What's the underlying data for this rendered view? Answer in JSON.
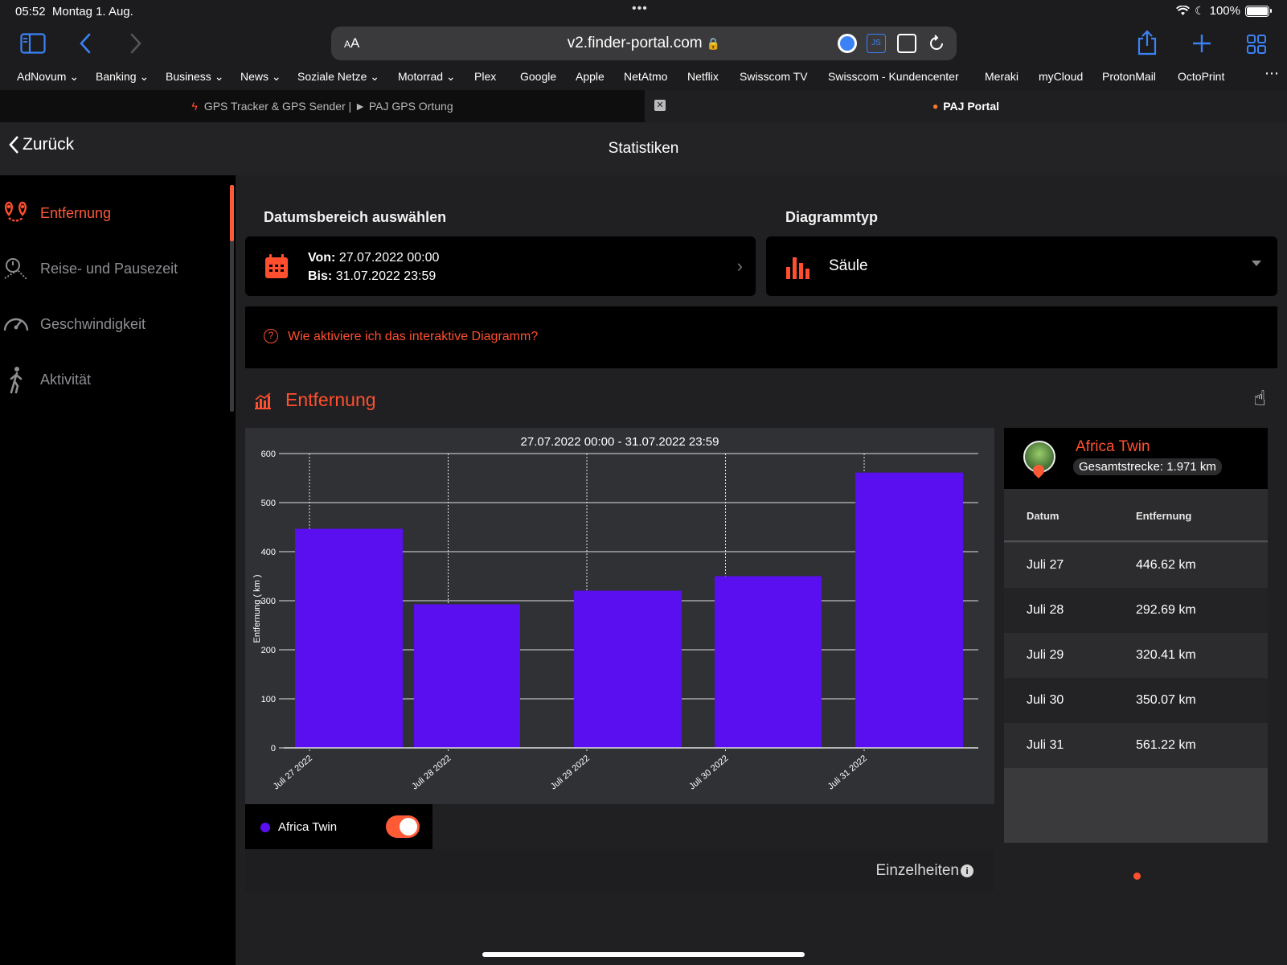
{
  "status_bar": {
    "time": "05:52",
    "date": "Montag 1. Aug.",
    "battery": "100%"
  },
  "toolbar": {
    "text_size_label": "AA",
    "url": "v2.finder-portal.com"
  },
  "bookmarks": [
    {
      "label": "AdNovum",
      "dropdown": true
    },
    {
      "label": "Banking",
      "dropdown": true
    },
    {
      "label": "Business",
      "dropdown": true
    },
    {
      "label": "News",
      "dropdown": true
    },
    {
      "label": "Soziale Netze",
      "dropdown": true
    },
    {
      "label": "Motorrad",
      "dropdown": true
    },
    {
      "label": "Plex",
      "dropdown": false
    },
    {
      "label": "Google",
      "dropdown": false
    },
    {
      "label": "Apple",
      "dropdown": false
    },
    {
      "label": "NetAtmo",
      "dropdown": false
    },
    {
      "label": "Netflix",
      "dropdown": false
    },
    {
      "label": "Swisscom TV",
      "dropdown": false
    },
    {
      "label": "Swisscom - Kundencenter",
      "dropdown": false
    },
    {
      "label": "Meraki",
      "dropdown": false
    },
    {
      "label": "myCloud",
      "dropdown": false
    },
    {
      "label": "ProtonMail",
      "dropdown": false
    },
    {
      "label": "OctoPrint",
      "dropdown": false
    }
  ],
  "tabs": [
    {
      "title": "GPS Tracker & GPS Sender | ► PAJ GPS Ortung",
      "active": false
    },
    {
      "title": "PAJ Portal",
      "active": true
    }
  ],
  "header": {
    "back_label": "Zurück",
    "title": "Statistiken"
  },
  "sidebar": {
    "items": [
      {
        "label": "Entfernung",
        "icon": "route-pins-icon",
        "active": true
      },
      {
        "label": "Reise- und Pausezeit",
        "icon": "travel-time-icon",
        "active": false
      },
      {
        "label": "Geschwindigkeit",
        "icon": "speedometer-icon",
        "active": false
      },
      {
        "label": "Aktivität",
        "icon": "walking-icon",
        "active": false
      }
    ]
  },
  "date_range": {
    "section_label": "Datumsbereich auswählen",
    "from_label": "Von:",
    "from_value": "27.07.2022 00:00",
    "to_label": "Bis:",
    "to_value": "31.07.2022 23:59"
  },
  "chart_type": {
    "section_label": "Diagrammtyp",
    "selected": "Säule"
  },
  "help_link": "Wie aktiviere ich das interaktive Diagramm?",
  "chart_section": {
    "title": "Entfernung",
    "details_label": "Einzelheiten"
  },
  "colors": {
    "accent": "#ff4f2e",
    "bar": "#5a0ff0",
    "chart_bg": "#2f3134"
  },
  "chart_data": {
    "type": "bar",
    "title": "27.07.2022  00:00  - 31.07.2022  23:59",
    "categories": [
      "Juli 27 2022",
      "Juli 28 2022",
      "Juli 29 2022",
      "Juli 30 2022",
      "Juli 31 2022"
    ],
    "series": [
      {
        "name": "Africa Twin",
        "values": [
          446.62,
          292.69,
          320.41,
          350.07,
          561.22
        ]
      }
    ],
    "ylabel": "Entfernung ( km )",
    "xlabel": "",
    "ylim": [
      0,
      600
    ],
    "yticks": [
      0,
      100,
      200,
      300,
      400,
      500,
      600
    ],
    "grid": true,
    "legend": "bottom-left"
  },
  "legend": {
    "series_name": "Africa Twin",
    "enabled": true
  },
  "vehicle": {
    "name": "Africa Twin",
    "total_label": "Gesamtstrecke: 1.971 km"
  },
  "table": {
    "col_date": "Datum",
    "col_distance": "Entfernung",
    "rows": [
      {
        "date": "Juli 27",
        "distance": "446.62 km"
      },
      {
        "date": "Juli 28",
        "distance": "292.69 km"
      },
      {
        "date": "Juli 29",
        "distance": "320.41 km"
      },
      {
        "date": "Juli 30",
        "distance": "350.07 km"
      },
      {
        "date": "Juli 31",
        "distance": "561.22 km"
      }
    ]
  }
}
